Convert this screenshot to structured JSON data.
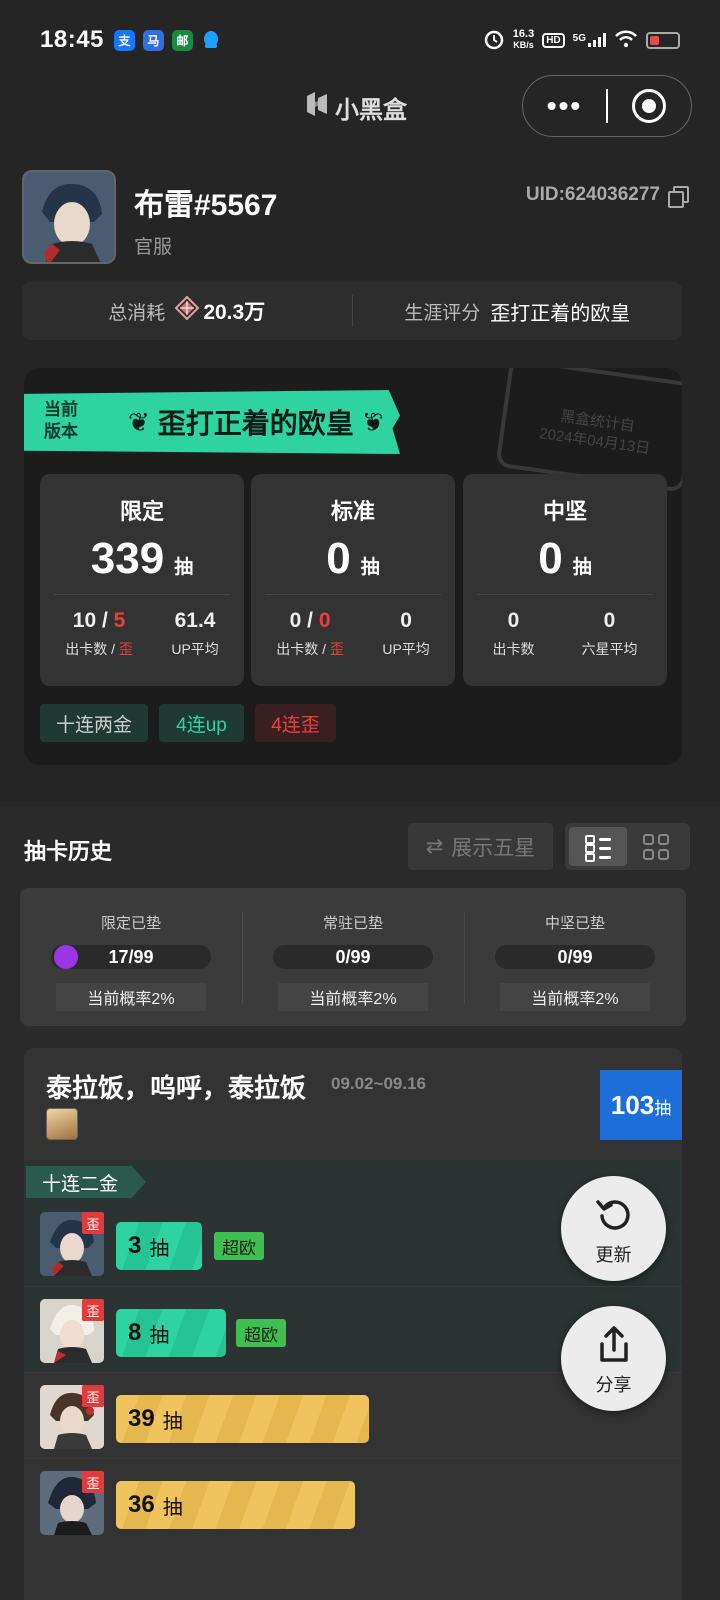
{
  "status_bar": {
    "time": "18:45",
    "apps": [
      {
        "icon": "alipay-icon",
        "glyph": "支",
        "color": "#1677ff"
      },
      {
        "icon": "app-icon",
        "glyph": "马",
        "color": "#2f6fe0"
      },
      {
        "icon": "app-icon",
        "glyph": "邮",
        "color": "#1a8a3e"
      },
      {
        "icon": "qq-icon",
        "glyph": "",
        "color": "#1ea0ff"
      }
    ],
    "net_speed_value": "16.3",
    "net_speed_unit": "KB/s",
    "hd_label": "HD",
    "network": "5G"
  },
  "header": {
    "brand": "小黑盒",
    "more_icon": "more-dots-icon",
    "target_icon": "target-icon"
  },
  "profile": {
    "username": "布雷#5567",
    "server": "官服",
    "uid": "UID:624036277",
    "copy_icon": "copy-icon"
  },
  "summary": {
    "consumption_label": "总消耗",
    "consumption_value": "20.3万",
    "rating_label": "生涯评分",
    "rating_value": "歪打正着的欧皇"
  },
  "version_card": {
    "tag": "当前版本",
    "tag_line1": "当前",
    "tag_line2": "版本",
    "title": "歪打正着的欧皇",
    "stamp_line1": "黑盒统计自",
    "stamp_line2": "2024年04月13日",
    "stats": [
      {
        "title": "限定",
        "count": "339",
        "unit": "抽",
        "left_value_a": "10",
        "left_value_sep": " / ",
        "left_value_b": "5",
        "left_label_a": "出卡数 / ",
        "left_label_b": "歪",
        "right_value": "61.4",
        "right_label": "UP平均"
      },
      {
        "title": "标准",
        "count": "0",
        "unit": "抽",
        "left_value_a": "0",
        "left_value_sep": " / ",
        "left_value_b": "0",
        "left_label_a": "出卡数 / ",
        "left_label_b": "歪",
        "right_value": "0",
        "right_label": "UP平均"
      },
      {
        "title": "中坚",
        "count": "0",
        "unit": "抽",
        "left_value_a": "0",
        "left_value_sep": "",
        "left_value_b": "",
        "left_label_a": "出卡数",
        "left_label_b": "",
        "right_value": "0",
        "right_label": "六星平均"
      }
    ],
    "tags": [
      {
        "label": "十连两金",
        "color": "#cccccc",
        "bg": "#1f3a32"
      },
      {
        "label": "4连up",
        "color": "#2ed3a0",
        "bg": "#1f3a32"
      },
      {
        "label": "4连歪",
        "color": "#e8403f",
        "bg": "#3a1f21"
      }
    ]
  },
  "history": {
    "title": "抽卡历史",
    "show_five_star": "展示五星",
    "swap_icon": "swap-icon",
    "list_view_icon": "list-view-icon",
    "grid_view_icon": "grid-view-icon",
    "pity": [
      {
        "label": "限定已垫",
        "value": "17/99",
        "progress": 0.17,
        "rate": "当前概率2%"
      },
      {
        "label": "常驻已垫",
        "value": "0/99",
        "progress": 0,
        "rate": "当前概率2%"
      },
      {
        "label": "中坚已垫",
        "value": "0/99",
        "progress": 0,
        "rate": "当前概率2%"
      }
    ],
    "banner": {
      "title": "泰拉饭，呜呼，泰拉饭",
      "date": "09.02~09.16",
      "total": "103",
      "total_unit": "抽",
      "group_tag": "十连二金",
      "pulls": [
        {
          "count": "3",
          "unit": "抽",
          "badge": "歪",
          "chip": "超欧",
          "color": "green"
        },
        {
          "count": "8",
          "unit": "抽",
          "badge": "歪",
          "chip": "超欧",
          "color": "green"
        },
        {
          "count": "39",
          "unit": "抽",
          "badge": "歪",
          "chip": "",
          "color": "yellow"
        },
        {
          "count": "36",
          "unit": "抽",
          "badge": "歪",
          "chip": "",
          "color": "yellow"
        }
      ]
    }
  },
  "fab": {
    "refresh_label": "更新",
    "refresh_icon": "refresh-icon",
    "share_label": "分享",
    "share_icon": "share-icon"
  }
}
